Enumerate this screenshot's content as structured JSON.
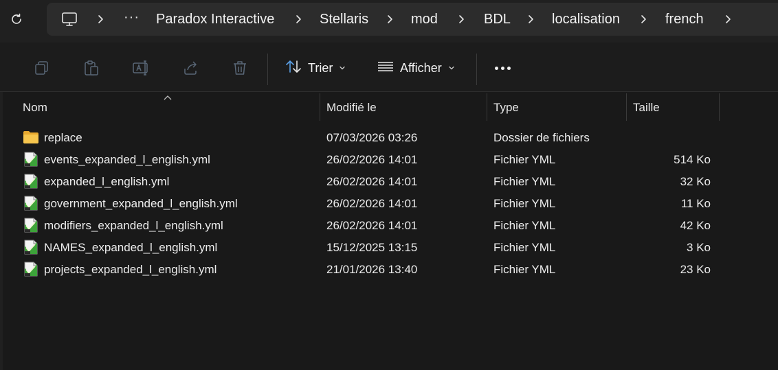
{
  "breadcrumb": {
    "ellipsis": "···",
    "items": [
      "Paradox Interactive",
      "Stellaris",
      "mod",
      "BDL",
      "localisation",
      "french"
    ]
  },
  "toolbar": {
    "sort_label": "Trier",
    "view_label": "Afficher",
    "icons": [
      "copy-icon",
      "paste-icon",
      "rename-icon",
      "share-icon",
      "delete-icon",
      "sort-icon",
      "view-icon",
      "more-icon"
    ]
  },
  "columns": {
    "name": "Nom",
    "modified": "Modifié le",
    "type": "Type",
    "size": "Taille"
  },
  "files": [
    {
      "name": "replace",
      "modified": "07/03/2026 03:26",
      "type": "Dossier de fichiers",
      "size": "",
      "icon": "folder-icon"
    },
    {
      "name": "events_expanded_l_english.yml",
      "modified": "26/02/2026 14:01",
      "type": "Fichier YML",
      "size": "514 Ko",
      "icon": "yml-file-icon"
    },
    {
      "name": "expanded_l_english.yml",
      "modified": "26/02/2026 14:01",
      "type": "Fichier YML",
      "size": "32 Ko",
      "icon": "yml-file-icon"
    },
    {
      "name": "government_expanded_l_english.yml",
      "modified": "26/02/2026 14:01",
      "type": "Fichier YML",
      "size": "11 Ko",
      "icon": "yml-file-icon"
    },
    {
      "name": "modifiers_expanded_l_english.yml",
      "modified": "26/02/2026 14:01",
      "type": "Fichier YML",
      "size": "42 Ko",
      "icon": "yml-file-icon"
    },
    {
      "name": "NAMES_expanded_l_english.yml",
      "modified": "15/12/2025 13:15",
      "type": "Fichier YML",
      "size": "3 Ko",
      "icon": "yml-file-icon"
    },
    {
      "name": "projects_expanded_l_english.yml",
      "modified": "21/01/2026 13:40",
      "type": "Fichier YML",
      "size": "23 Ko",
      "icon": "yml-file-icon"
    }
  ],
  "colors": {
    "background": "#191919",
    "address_bar": "#2c2c2c",
    "folder": "#f5c04a",
    "sort_accent": "#5aa0e6"
  }
}
